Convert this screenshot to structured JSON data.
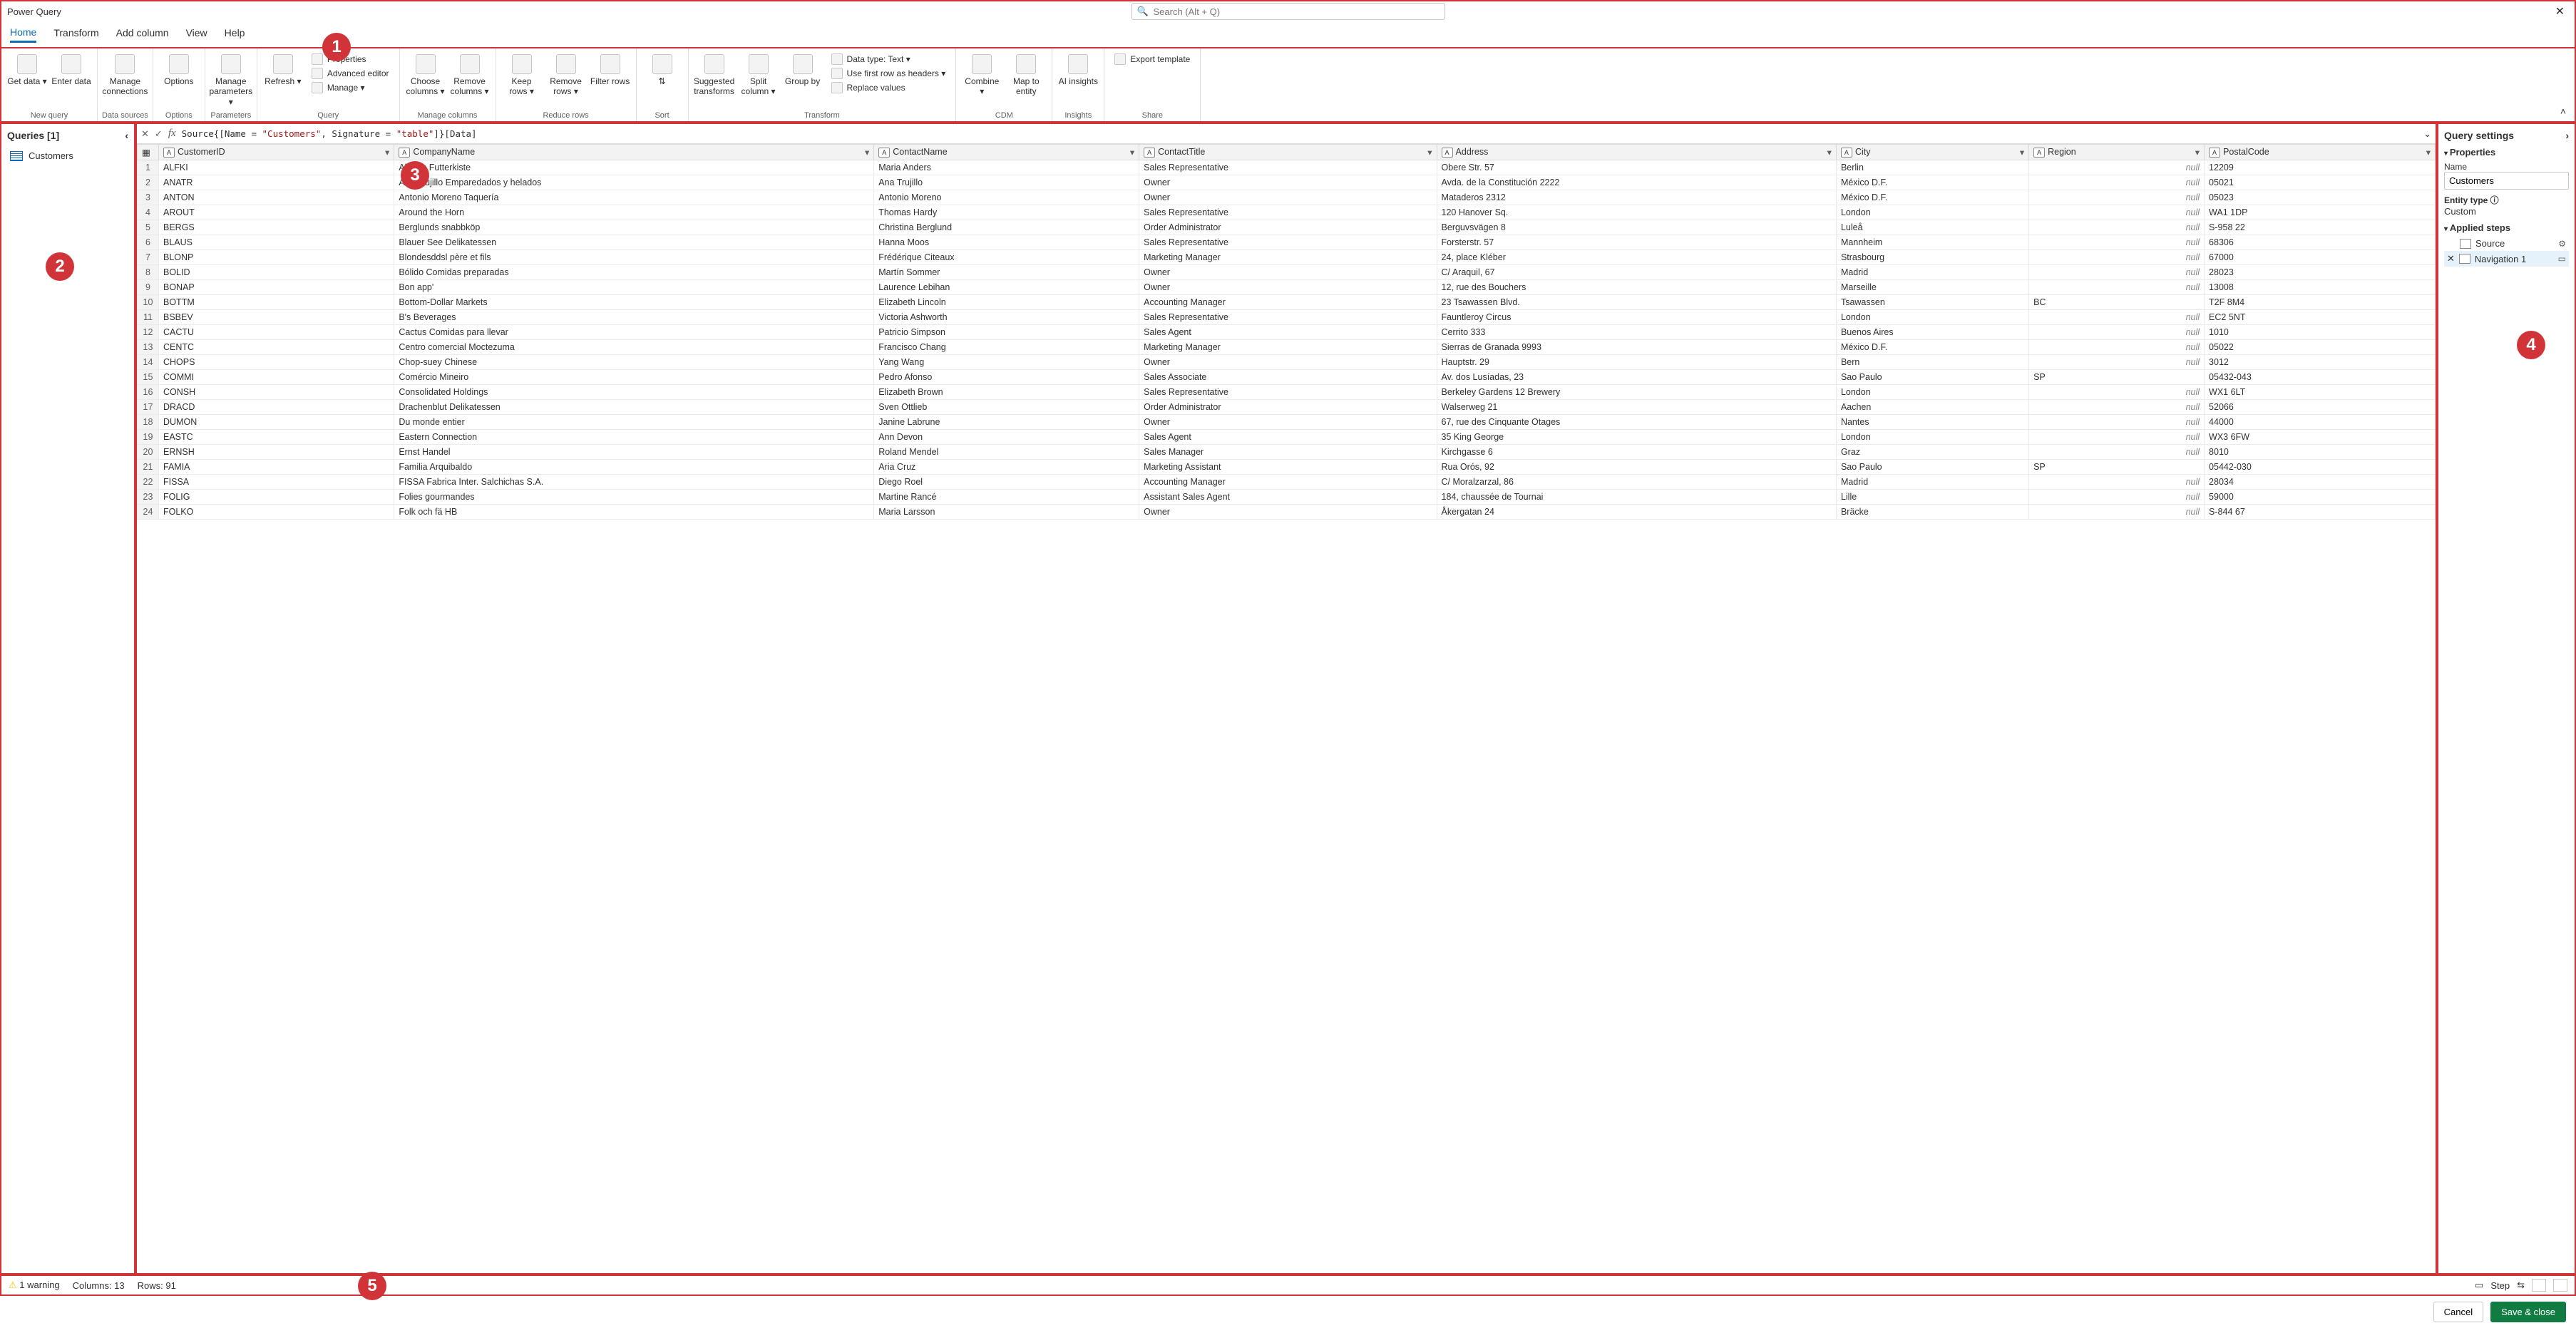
{
  "app_title": "Power Query",
  "search_placeholder": "Search (Alt + Q)",
  "tabs": [
    "Home",
    "Transform",
    "Add column",
    "View",
    "Help"
  ],
  "ribbon": {
    "groups": [
      {
        "label": "New query",
        "buttons": [
          {
            "l": "Get data ▾"
          },
          {
            "l": "Enter data"
          }
        ]
      },
      {
        "label": "Data sources",
        "buttons": [
          {
            "l": "Manage connections"
          }
        ]
      },
      {
        "label": "Options",
        "buttons": [
          {
            "l": "Options"
          }
        ]
      },
      {
        "label": "Parameters",
        "buttons": [
          {
            "l": "Manage parameters ▾"
          }
        ]
      },
      {
        "label": "Query",
        "buttons": [
          {
            "l": "Refresh ▾"
          }
        ],
        "small": [
          {
            "l": "Properties"
          },
          {
            "l": "Advanced editor"
          },
          {
            "l": "Manage ▾"
          }
        ]
      },
      {
        "label": "Manage columns",
        "buttons": [
          {
            "l": "Choose columns ▾"
          },
          {
            "l": "Remove columns ▾"
          }
        ]
      },
      {
        "label": "Reduce rows",
        "buttons": [
          {
            "l": "Keep rows ▾"
          },
          {
            "l": "Remove rows ▾"
          },
          {
            "l": "Filter rows"
          }
        ]
      },
      {
        "label": "Sort",
        "buttons": [
          {
            "l": "⇅"
          }
        ]
      },
      {
        "label": "Transform",
        "buttons": [
          {
            "l": "Suggested transforms"
          },
          {
            "l": "Split column ▾"
          },
          {
            "l": "Group by"
          }
        ],
        "small": [
          {
            "l": "Data type: Text ▾"
          },
          {
            "l": "Use first row as headers ▾"
          },
          {
            "l": "Replace values"
          }
        ]
      },
      {
        "label": "CDM",
        "buttons": [
          {
            "l": "Combine ▾"
          },
          {
            "l": "Map to entity"
          }
        ]
      },
      {
        "label": "Insights",
        "buttons": [
          {
            "l": "AI insights"
          }
        ]
      },
      {
        "label": "Share",
        "small": [
          {
            "l": "Export template"
          }
        ]
      }
    ]
  },
  "queries_header": "Queries [1]",
  "queries": [
    "Customers"
  ],
  "formula_prefix": "Source{[Name = ",
  "formula_s1": "\"Customers\"",
  "formula_mid": ", Signature = ",
  "formula_s2": "\"table\"",
  "formula_suffix": "]}[Data]",
  "columns": [
    "CustomerID",
    "CompanyName",
    "ContactName",
    "ContactTitle",
    "Address",
    "City",
    "Region",
    "PostalCode"
  ],
  "rows": [
    [
      "ALFKI",
      "Alfreds Futterkiste",
      "Maria Anders",
      "Sales Representative",
      "Obere Str. 57",
      "Berlin",
      null,
      "12209"
    ],
    [
      "ANATR",
      "Ana Trujillo Emparedados y helados",
      "Ana Trujillo",
      "Owner",
      "Avda. de la Constitución 2222",
      "México D.F.",
      null,
      "05021"
    ],
    [
      "ANTON",
      "Antonio Moreno Taquería",
      "Antonio Moreno",
      "Owner",
      "Mataderos  2312",
      "México D.F.",
      null,
      "05023"
    ],
    [
      "AROUT",
      "Around the Horn",
      "Thomas Hardy",
      "Sales Representative",
      "120 Hanover Sq.",
      "London",
      null,
      "WA1 1DP"
    ],
    [
      "BERGS",
      "Berglunds snabbköp",
      "Christina Berglund",
      "Order Administrator",
      "Berguvsvägen  8",
      "Luleå",
      null,
      "S-958 22"
    ],
    [
      "BLAUS",
      "Blauer See Delikatessen",
      "Hanna Moos",
      "Sales Representative",
      "Forsterstr. 57",
      "Mannheim",
      null,
      "68306"
    ],
    [
      "BLONP",
      "Blondesddsl père et fils",
      "Frédérique Citeaux",
      "Marketing Manager",
      "24, place Kléber",
      "Strasbourg",
      null,
      "67000"
    ],
    [
      "BOLID",
      "Bólido Comidas preparadas",
      "Martín Sommer",
      "Owner",
      "C/ Araquil, 67",
      "Madrid",
      null,
      "28023"
    ],
    [
      "BONAP",
      "Bon app'",
      "Laurence Lebihan",
      "Owner",
      "12, rue des Bouchers",
      "Marseille",
      null,
      "13008"
    ],
    [
      "BOTTM",
      "Bottom-Dollar Markets",
      "Elizabeth Lincoln",
      "Accounting Manager",
      "23 Tsawassen Blvd.",
      "Tsawassen",
      "BC",
      "T2F 8M4"
    ],
    [
      "BSBEV",
      "B's Beverages",
      "Victoria Ashworth",
      "Sales Representative",
      "Fauntleroy Circus",
      "London",
      null,
      "EC2 5NT"
    ],
    [
      "CACTU",
      "Cactus Comidas para llevar",
      "Patricio Simpson",
      "Sales Agent",
      "Cerrito 333",
      "Buenos Aires",
      null,
      "1010"
    ],
    [
      "CENTC",
      "Centro comercial Moctezuma",
      "Francisco Chang",
      "Marketing Manager",
      "Sierras de Granada 9993",
      "México D.F.",
      null,
      "05022"
    ],
    [
      "CHOPS",
      "Chop-suey Chinese",
      "Yang Wang",
      "Owner",
      "Hauptstr. 29",
      "Bern",
      null,
      "3012"
    ],
    [
      "COMMI",
      "Comércio Mineiro",
      "Pedro Afonso",
      "Sales Associate",
      "Av. dos Lusíadas, 23",
      "Sao Paulo",
      "SP",
      "05432-043"
    ],
    [
      "CONSH",
      "Consolidated Holdings",
      "Elizabeth Brown",
      "Sales Representative",
      "Berkeley Gardens 12  Brewery",
      "London",
      null,
      "WX1 6LT"
    ],
    [
      "DRACD",
      "Drachenblut Delikatessen",
      "Sven Ottlieb",
      "Order Administrator",
      "Walserweg 21",
      "Aachen",
      null,
      "52066"
    ],
    [
      "DUMON",
      "Du monde entier",
      "Janine Labrune",
      "Owner",
      "67, rue des Cinquante Otages",
      "Nantes",
      null,
      "44000"
    ],
    [
      "EASTC",
      "Eastern Connection",
      "Ann Devon",
      "Sales Agent",
      "35 King George",
      "London",
      null,
      "WX3 6FW"
    ],
    [
      "ERNSH",
      "Ernst Handel",
      "Roland Mendel",
      "Sales Manager",
      "Kirchgasse 6",
      "Graz",
      null,
      "8010"
    ],
    [
      "FAMIA",
      "Familia Arquibaldo",
      "Aria Cruz",
      "Marketing Assistant",
      "Rua Orós, 92",
      "Sao Paulo",
      "SP",
      "05442-030"
    ],
    [
      "FISSA",
      "FISSA Fabrica Inter. Salchichas S.A.",
      "Diego Roel",
      "Accounting Manager",
      "C/ Moralzarzal, 86",
      "Madrid",
      null,
      "28034"
    ],
    [
      "FOLIG",
      "Folies gourmandes",
      "Martine Rancé",
      "Assistant Sales Agent",
      "184, chaussée de Tournai",
      "Lille",
      null,
      "59000"
    ],
    [
      "FOLKO",
      "Folk och fä HB",
      "Maria Larsson",
      "Owner",
      "Åkergatan 24",
      "Bräcke",
      null,
      "S-844 67"
    ]
  ],
  "settings": {
    "title": "Query settings",
    "prop_section": "Properties",
    "name_label": "Name",
    "name_value": "Customers",
    "entity_label": "Entity type ⓘ",
    "entity_value": "Custom",
    "steps_section": "Applied steps",
    "steps": [
      "Source",
      "Navigation 1"
    ]
  },
  "status": {
    "warning": "1 warning",
    "columns": "Columns: 13",
    "rows": "Rows: 91",
    "step_label": "Step"
  },
  "footer": {
    "cancel": "Cancel",
    "save": "Save & close"
  }
}
